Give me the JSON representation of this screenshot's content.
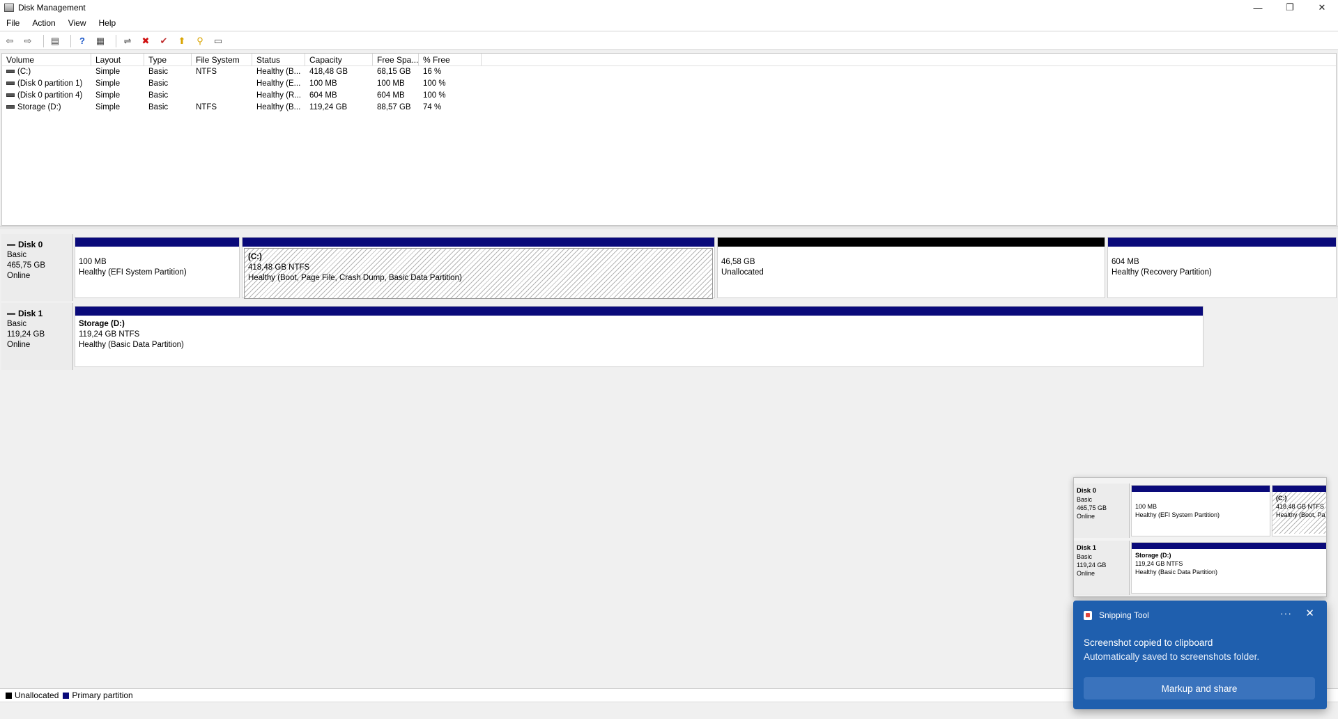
{
  "window": {
    "title": "Disk Management",
    "min": "—",
    "restore": "❐",
    "close": "✕"
  },
  "menu": [
    "File",
    "Action",
    "View",
    "Help"
  ],
  "toolbar": {
    "icons": [
      "back-icon",
      "forward-icon",
      "console-tree-icon",
      "help-icon",
      "properties-icon",
      "connect-icon",
      "delete-icon",
      "check-icon",
      "export-icon",
      "search-icon",
      "refresh-icon"
    ],
    "glyphs": [
      "⇦",
      "⇨",
      "▤",
      "?",
      "▦",
      "⇌",
      "✖",
      "✔",
      "⬆",
      "⚲",
      "▭"
    ]
  },
  "volume_list": {
    "headers": [
      "Volume",
      "Layout",
      "Type",
      "File System",
      "Status",
      "Capacity",
      "Free Spa...",
      "% Free"
    ],
    "rows": [
      [
        "(C:)",
        "Simple",
        "Basic",
        "NTFS",
        "Healthy (B...",
        "418,48 GB",
        "68,15 GB",
        "16 %"
      ],
      [
        "(Disk 0 partition 1)",
        "Simple",
        "Basic",
        "",
        "Healthy (E...",
        "100 MB",
        "100 MB",
        "100 %"
      ],
      [
        "(Disk 0 partition 4)",
        "Simple",
        "Basic",
        "",
        "Healthy (R...",
        "604 MB",
        "604 MB",
        "100 %"
      ],
      [
        "Storage (D:)",
        "Simple",
        "Basic",
        "NTFS",
        "Healthy (B...",
        "119,24 GB",
        "88,57 GB",
        "74 %"
      ]
    ]
  },
  "disks": [
    {
      "name": "Disk 0",
      "type": "Basic",
      "size": "465,75 GB",
      "state": "Online",
      "partitions": [
        {
          "name": "",
          "size": "100 MB",
          "status": "Healthy (EFI System Partition)"
        },
        {
          "name": "(C:)",
          "size": "418,48 GB NTFS",
          "status": "Healthy (Boot, Page File, Crash Dump, Basic Data Partition)"
        },
        {
          "name": "",
          "size": "46,58 GB",
          "status": "Unallocated"
        },
        {
          "name": "",
          "size": "604 MB",
          "status": "Healthy (Recovery Partition)"
        }
      ]
    },
    {
      "name": "Disk 1",
      "type": "Basic",
      "size": "119,24 GB",
      "state": "Online",
      "partitions": [
        {
          "name": "Storage  (D:)",
          "size": "119,24 GB NTFS",
          "status": "Healthy (Basic Data Partition)"
        }
      ]
    }
  ],
  "legend": {
    "unallocated": "Unallocated",
    "primary": "Primary partition"
  },
  "colors": {
    "primary": "#0a0a7a",
    "unallocated": "#000000",
    "toast": "#1f5fae"
  },
  "preview": {
    "disk0": {
      "name": "Disk 0",
      "type": "Basic",
      "size": "465,75 GB",
      "state": "Online",
      "p1": {
        "size": "100 MB",
        "status": "Healthy (EFI System Partition)"
      },
      "p2": {
        "name": "(C:)",
        "size": "418,48 GB NTFS",
        "status": "Healthy (Boot, Pa"
      }
    },
    "disk1": {
      "name": "Disk 1",
      "type": "Basic",
      "size": "119,24 GB",
      "state": "Online",
      "p1": {
        "name": "Storage  (D:)",
        "size": "119,24 GB NTFS",
        "status": "Healthy (Basic Data Partition)"
      }
    }
  },
  "toast": {
    "app": "Snipping Tool",
    "more": "···",
    "close": "✕",
    "message": "Screenshot copied to clipboard",
    "sub": "Automatically saved to screenshots folder.",
    "button": "Markup and share"
  }
}
